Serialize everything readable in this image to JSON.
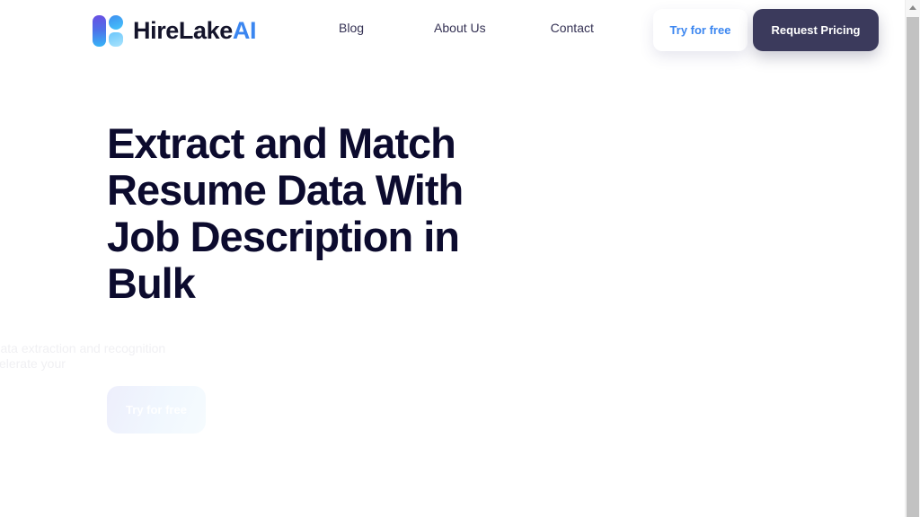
{
  "header": {
    "logo": {
      "text_primary": "HireLake",
      "text_accent": "AI",
      "mark_gradient_start": "#6a4fe3",
      "mark_gradient_end": "#36b6f7",
      "accent_color": "#3b86f0"
    },
    "nav": [
      {
        "label": "Blog"
      },
      {
        "label": "About Us"
      },
      {
        "label": "Contact"
      }
    ],
    "buttons": {
      "try_free_label": "Try for free",
      "try_free_color": "#3b86f0",
      "request_pricing_label": "Request Pricing",
      "request_pricing_bg": "#3b3a5c"
    }
  },
  "hero": {
    "title": "Extract and Match Resume Data With Job Description in Bulk",
    "subtitle": "Use AI powered data extraction and recognition technology to accelerate your",
    "cta_label": "Try for free",
    "title_color": "#0c0b2e"
  },
  "scrollbar": {
    "up_arrow": "scroll-up-arrow",
    "thumb": "scroll-thumb"
  }
}
